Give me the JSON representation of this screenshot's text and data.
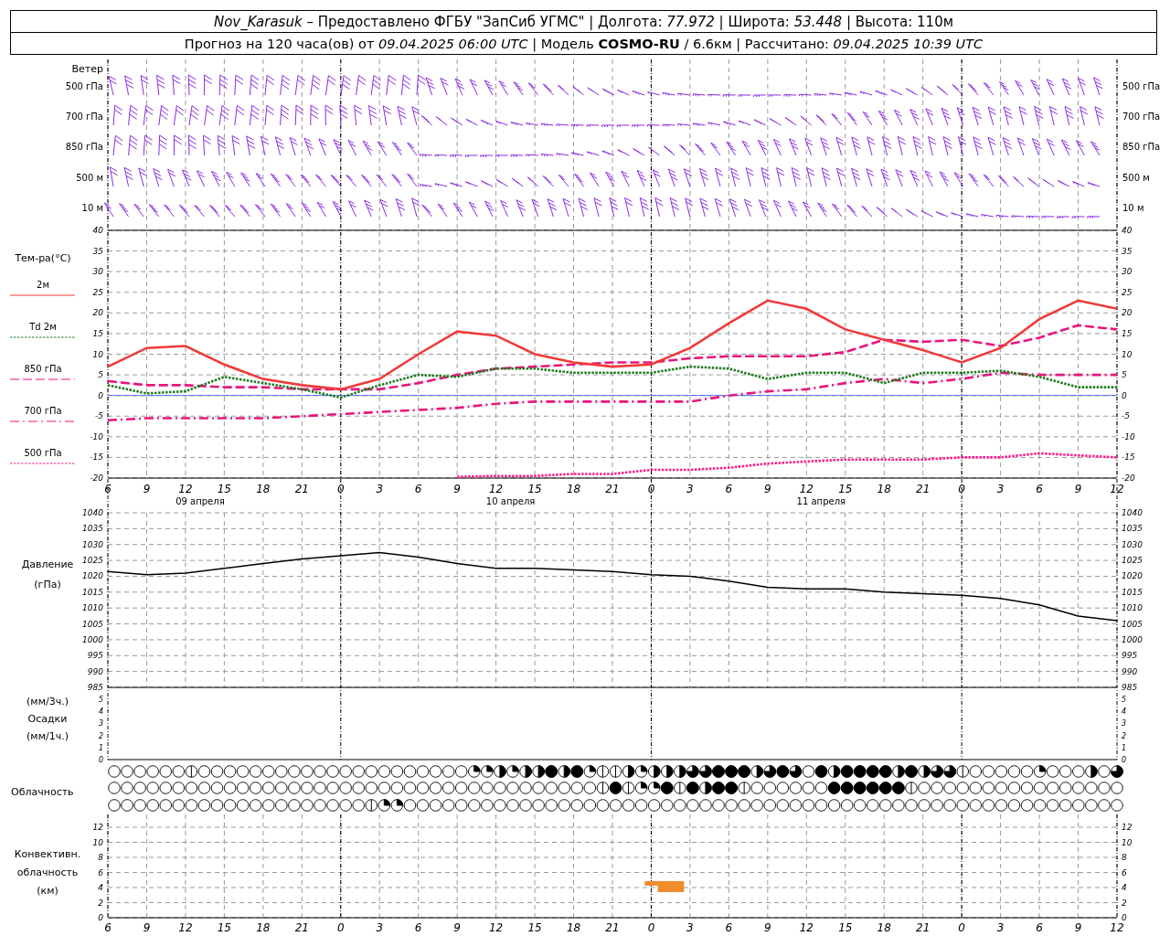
{
  "header": {
    "line_1": "*Nov_Karasuk* – Предоставлено ФГБУ \"ЗапСиб УГМС\" | Долгота: *77.972* | Широта: *53.448* | Высота: 110м",
    "line_2": "Прогноз на 120 часа(ов) от *09.04.2025 06:00 UTC* | Модель **COSMO-RU** / 6.6км | Рассчитано: *09.04.2025 10:39 UTC*"
  },
  "wind": {
    "title": "Ветер",
    "levels": [
      {
        "left": "500 гПа",
        "right": "500 гПа"
      },
      {
        "left": "700 гПа",
        "right": "700 гПа"
      },
      {
        "left": "850 гПа",
        "right": "850 гПа"
      },
      {
        "left": "500 м",
        "right": "500 м"
      },
      {
        "left": "10 м",
        "right": "10 м"
      }
    ]
  },
  "temperature": {
    "title": "Тем-ра(°C)",
    "right_axis": [
      "40",
      "35",
      "30",
      "25",
      "20",
      "15",
      "10",
      "5",
      "0",
      "-5",
      "-10",
      "-15",
      "-20"
    ],
    "dates": [
      "09 апреля",
      "10 апреля",
      "11 апреля"
    ],
    "chart_data": {
      "type": "line",
      "categories": [
        "6",
        "9",
        "12",
        "15",
        "18",
        "21",
        "0",
        "3",
        "6",
        "9",
        "12",
        "15",
        "18",
        "21",
        "0",
        "3",
        "6",
        "9",
        "12",
        "15",
        "18",
        "21",
        "0",
        "3",
        "6",
        "9",
        "12"
      ],
      "ylim": [
        -20,
        40
      ],
      "yticks": [
        -20,
        -15,
        -10,
        -5,
        0,
        5,
        10,
        15,
        20,
        25,
        30,
        35,
        40
      ],
      "series": [
        {
          "name": "2м",
          "color": "#f03a3a",
          "line_style": "solid",
          "values": [
            7,
            11.5,
            12,
            7.5,
            4,
            2.5,
            1.5,
            4,
            10,
            15.5,
            14.5,
            10,
            8,
            7,
            7.5,
            11.5,
            17.5,
            23,
            21,
            16,
            13.5,
            11,
            8,
            11.5,
            18.5,
            23,
            21
          ]
        },
        {
          "name": "Td 2м",
          "color": "#1f7a1f",
          "line_style": "dotted",
          "values": [
            2.5,
            0.5,
            1,
            4.5,
            3,
            1.5,
            -0.5,
            2.5,
            5,
            4.5,
            6.5,
            6.5,
            5.5,
            5.5,
            5.5,
            7,
            6.5,
            4,
            5.5,
            5.5,
            3,
            5.5,
            5.5,
            6,
            4.5,
            2,
            2
          ]
        },
        {
          "name": "850 гПа",
          "color": "#e8157e",
          "line_style": "dashed",
          "values": [
            3.5,
            2.5,
            2.5,
            2,
            2,
            1.5,
            1.5,
            1.5,
            3,
            5,
            6.5,
            7,
            7.5,
            8,
            8,
            9,
            9.5,
            9.5,
            9.5,
            10.5,
            13.5,
            13,
            13.5,
            12,
            14,
            17,
            16
          ]
        },
        {
          "name": "700 гПа",
          "color": "#e8157e",
          "line_style": "dashdot",
          "values": [
            -6,
            -5.5,
            -5.5,
            -5.5,
            -5.5,
            -5,
            -4.5,
            -4,
            -3.5,
            -3,
            -2,
            -1.5,
            -1.5,
            -1.5,
            -1.5,
            -1.5,
            0,
            1,
            1.5,
            3,
            4,
            3,
            4,
            5.5,
            5,
            5,
            5
          ]
        },
        {
          "name": "500 гПа",
          "color": "#ff1a8c",
          "line_style": "dotted",
          "values": [
            null,
            null,
            null,
            null,
            null,
            null,
            null,
            null,
            null,
            -19.7,
            -19.5,
            -19.5,
            -19,
            -19,
            -18,
            -18,
            -17.5,
            -16.5,
            -16,
            -15.5,
            -15.5,
            -15.5,
            -15,
            -15,
            -14,
            -14.5,
            -15
          ]
        }
      ]
    }
  },
  "pressure": {
    "unit": "(гПа)",
    "right_axis": [
      "1040",
      "1035",
      "1030",
      "1025",
      "1020",
      "1015",
      "1010",
      "1005",
      "1000",
      "995",
      "990",
      "985"
    ],
    "chart_data": {
      "type": "line",
      "categories": [
        null,
        null,
        null,
        null,
        null,
        null,
        null,
        null,
        null,
        null,
        null,
        null,
        null,
        null,
        null,
        null,
        null,
        null,
        null,
        null,
        null,
        null,
        null,
        null,
        null,
        null,
        null
      ],
      "ylim": [
        985,
        1040
      ],
      "yticks": [
        985,
        990,
        995,
        1000,
        1005,
        1010,
        1015,
        1020,
        1025,
        1030,
        1035,
        1040
      ],
      "series": [
        {
          "name": "Давление",
          "color": "#000000",
          "values": [
            1021.5,
            1020.5,
            1021,
            1022.5,
            1024,
            1025.5,
            1026.5,
            1027.5,
            1026,
            1024,
            1022.5,
            1022.5,
            1022,
            1021.5,
            1020.5,
            1020,
            1018.5,
            1016.5,
            1016,
            1016,
            1015,
            1014.5,
            1014,
            1013,
            1011,
            1007.5,
            1006
          ]
        }
      ]
    }
  },
  "precipitation": {
    "labels": [
      "(мм/3ч.)",
      "Осадки",
      "(мм/1ч.)"
    ],
    "left_axis": [
      "5",
      "4",
      "3",
      "2",
      "1",
      "0"
    ],
    "right_axis": [
      "5",
      "4",
      "3",
      "2",
      "1",
      "0"
    ]
  },
  "clouds": {
    "title": "Облачность",
    "rows": [
      {
        "circles": [
          {
            "kind": "clear"
          },
          {
            "kind": "clear"
          },
          {
            "kind": "clear"
          },
          {
            "kind": "clear"
          },
          {
            "kind": "clear"
          },
          {
            "kind": "clear"
          },
          {
            "kind": "trace"
          },
          {
            "kind": "clear"
          },
          {
            "kind": "clear"
          },
          {
            "kind": "clear"
          },
          {
            "kind": "clear"
          },
          {
            "kind": "clear"
          },
          {
            "kind": "clear"
          },
          {
            "kind": "clear"
          },
          {
            "kind": "clear"
          },
          {
            "kind": "clear"
          },
          {
            "kind": "clear"
          },
          {
            "kind": "clear"
          },
          {
            "kind": "clear"
          },
          {
            "kind": "clear"
          },
          {
            "kind": "clear"
          },
          {
            "kind": "clear"
          },
          {
            "kind": "clear"
          },
          {
            "kind": "clear"
          },
          {
            "kind": "clear"
          },
          {
            "kind": "clear"
          },
          {
            "kind": "clear"
          },
          {
            "kind": "clear"
          },
          {
            "kind": "quarter"
          },
          {
            "kind": "quarter"
          },
          {
            "kind": "half"
          },
          {
            "kind": "quarter"
          },
          {
            "kind": "half"
          },
          {
            "kind": "half"
          },
          {
            "kind": "overcast"
          },
          {
            "kind": "half"
          },
          {
            "kind": "overcast"
          },
          {
            "kind": "quarter"
          },
          {
            "kind": "trace"
          },
          {
            "kind": "trace"
          },
          {
            "kind": "half"
          },
          {
            "kind": "quarter"
          },
          {
            "kind": "half"
          },
          {
            "kind": "half"
          },
          {
            "kind": "half"
          },
          {
            "kind": "most"
          },
          {
            "kind": "most"
          },
          {
            "kind": "overcast"
          },
          {
            "kind": "overcast"
          },
          {
            "kind": "overcast"
          },
          {
            "kind": "half"
          },
          {
            "kind": "most"
          },
          {
            "kind": "overcast"
          },
          {
            "kind": "most"
          },
          {
            "kind": "clear"
          },
          {
            "kind": "overcast"
          },
          {
            "kind": "half"
          },
          {
            "kind": "overcast"
          },
          {
            "kind": "overcast"
          },
          {
            "kind": "overcast"
          },
          {
            "kind": "overcast"
          },
          {
            "kind": "half"
          },
          {
            "kind": "overcast"
          },
          {
            "kind": "half"
          },
          {
            "kind": "most"
          },
          {
            "kind": "most"
          },
          {
            "kind": "trace"
          },
          {
            "kind": "clear"
          },
          {
            "kind": "clear"
          },
          {
            "kind": "clear"
          },
          {
            "kind": "clear"
          },
          {
            "kind": "clear"
          },
          {
            "kind": "quarter"
          },
          {
            "kind": "clear"
          },
          {
            "kind": "clear"
          },
          {
            "kind": "clear"
          },
          {
            "kind": "half"
          },
          {
            "kind": "clear"
          },
          {
            "kind": "most"
          }
        ]
      },
      {
        "circles": [
          {
            "kind": "clear"
          },
          {
            "kind": "clear"
          },
          {
            "kind": "clear"
          },
          {
            "kind": "clear"
          },
          {
            "kind": "clear"
          },
          {
            "kind": "clear"
          },
          {
            "kind": "clear"
          },
          {
            "kind": "clear"
          },
          {
            "kind": "clear"
          },
          {
            "kind": "clear"
          },
          {
            "kind": "clear"
          },
          {
            "kind": "clear"
          },
          {
            "kind": "clear"
          },
          {
            "kind": "clear"
          },
          {
            "kind": "clear"
          },
          {
            "kind": "clear"
          },
          {
            "kind": "clear"
          },
          {
            "kind": "clear"
          },
          {
            "kind": "clear"
          },
          {
            "kind": "clear"
          },
          {
            "kind": "clear"
          },
          {
            "kind": "clear"
          },
          {
            "kind": "clear"
          },
          {
            "kind": "clear"
          },
          {
            "kind": "clear"
          },
          {
            "kind": "clear"
          },
          {
            "kind": "clear"
          },
          {
            "kind": "clear"
          },
          {
            "kind": "clear"
          },
          {
            "kind": "clear"
          },
          {
            "kind": "clear"
          },
          {
            "kind": "clear"
          },
          {
            "kind": "clear"
          },
          {
            "kind": "clear"
          },
          {
            "kind": "clear"
          },
          {
            "kind": "clear"
          },
          {
            "kind": "clear"
          },
          {
            "kind": "clear"
          },
          {
            "kind": "trace"
          },
          {
            "kind": "overcast"
          },
          {
            "kind": "trace"
          },
          {
            "kind": "quarter"
          },
          {
            "kind": "quarter"
          },
          {
            "kind": "overcast"
          },
          {
            "kind": "trace"
          },
          {
            "kind": "overcast"
          },
          {
            "kind": "half"
          },
          {
            "kind": "overcast"
          },
          {
            "kind": "overcast"
          },
          {
            "kind": "trace"
          },
          {
            "kind": "clear"
          },
          {
            "kind": "clear"
          },
          {
            "kind": "clear"
          },
          {
            "kind": "clear"
          },
          {
            "kind": "clear"
          },
          {
            "kind": "clear"
          },
          {
            "kind": "overcast"
          },
          {
            "kind": "overcast"
          },
          {
            "kind": "overcast"
          },
          {
            "kind": "overcast"
          },
          {
            "kind": "overcast"
          },
          {
            "kind": "overcast"
          },
          {
            "kind": "trace"
          },
          {
            "kind": "clear"
          },
          {
            "kind": "clear"
          },
          {
            "kind": "clear"
          },
          {
            "kind": "clear"
          },
          {
            "kind": "clear"
          },
          {
            "kind": "clear"
          },
          {
            "kind": "clear"
          },
          {
            "kind": "clear"
          },
          {
            "kind": "clear"
          },
          {
            "kind": "clear"
          },
          {
            "kind": "clear"
          },
          {
            "kind": "clear"
          },
          {
            "kind": "clear"
          },
          {
            "kind": "clear"
          },
          {
            "kind": "clear"
          },
          {
            "kind": "clear"
          }
        ]
      },
      {
        "circles": [
          {
            "kind": "clear"
          },
          {
            "kind": "clear"
          },
          {
            "kind": "clear"
          },
          {
            "kind": "clear"
          },
          {
            "kind": "clear"
          },
          {
            "kind": "clear"
          },
          {
            "kind": "clear"
          },
          {
            "kind": "clear"
          },
          {
            "kind": "clear"
          },
          {
            "kind": "clear"
          },
          {
            "kind": "clear"
          },
          {
            "kind": "clear"
          },
          {
            "kind": "clear"
          },
          {
            "kind": "clear"
          },
          {
            "kind": "clear"
          },
          {
            "kind": "clear"
          },
          {
            "kind": "clear"
          },
          {
            "kind": "clear"
          },
          {
            "kind": "clear"
          },
          {
            "kind": "clear"
          },
          {
            "kind": "trace"
          },
          {
            "kind": "quarter"
          },
          {
            "kind": "quarter"
          },
          {
            "kind": "clear"
          },
          {
            "kind": "clear"
          },
          {
            "kind": "clear"
          },
          {
            "kind": "clear"
          },
          {
            "kind": "clear"
          },
          {
            "kind": "clear"
          },
          {
            "kind": "clear"
          },
          {
            "kind": "clear"
          },
          {
            "kind": "clear"
          },
          {
            "kind": "clear"
          },
          {
            "kind": "clear"
          },
          {
            "kind": "clear"
          },
          {
            "kind": "clear"
          },
          {
            "kind": "clear"
          },
          {
            "kind": "clear"
          },
          {
            "kind": "clear"
          },
          {
            "kind": "clear"
          },
          {
            "kind": "clear"
          },
          {
            "kind": "clear"
          },
          {
            "kind": "clear"
          },
          {
            "kind": "clear"
          },
          {
            "kind": "clear"
          },
          {
            "kind": "clear"
          },
          {
            "kind": "clear"
          },
          {
            "kind": "clear"
          },
          {
            "kind": "clear"
          },
          {
            "kind": "clear"
          },
          {
            "kind": "clear"
          },
          {
            "kind": "clear"
          },
          {
            "kind": "clear"
          },
          {
            "kind": "clear"
          },
          {
            "kind": "clear"
          },
          {
            "kind": "clear"
          },
          {
            "kind": "clear"
          },
          {
            "kind": "clear"
          },
          {
            "kind": "clear"
          },
          {
            "kind": "clear"
          },
          {
            "kind": "clear"
          },
          {
            "kind": "clear"
          },
          {
            "kind": "clear"
          },
          {
            "kind": "clear"
          },
          {
            "kind": "clear"
          },
          {
            "kind": "clear"
          },
          {
            "kind": "clear"
          },
          {
            "kind": "clear"
          },
          {
            "kind": "clear"
          },
          {
            "kind": "clear"
          },
          {
            "kind": "clear"
          },
          {
            "kind": "clear"
          },
          {
            "kind": "clear"
          },
          {
            "kind": "clear"
          },
          {
            "kind": "clear"
          },
          {
            "kind": "clear"
          },
          {
            "kind": "clear"
          },
          {
            "kind": "clear"
          },
          {
            "kind": "clear"
          }
        ]
      }
    ]
  },
  "convective": {
    "labels": [
      "Конвективн.",
      "облачность",
      "(км)"
    ],
    "left_axis": [
      "12",
      "10",
      "8",
      "6",
      "4",
      "2",
      "0"
    ],
    "right_axis": [
      "12",
      "10",
      "8",
      "6",
      "4",
      "2",
      "0"
    ]
  },
  "bottom_axis": [
    "6",
    "9",
    "12",
    "15",
    "18",
    "21",
    "0",
    "3",
    "6",
    "9",
    "12",
    "15",
    "18",
    "21",
    "0",
    "3",
    "6",
    "9",
    "12",
    "15",
    "18",
    "21",
    "0",
    "3",
    "6",
    "9",
    "12"
  ]
}
